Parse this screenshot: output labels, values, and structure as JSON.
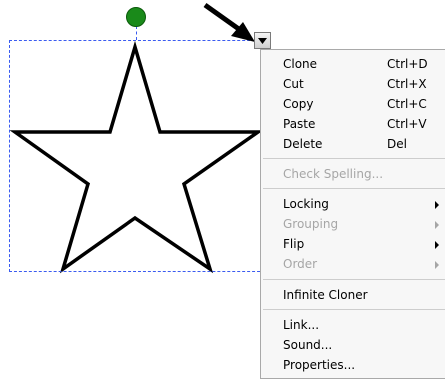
{
  "menu": {
    "clone": {
      "label": "Clone",
      "shortcut": "Ctrl+D"
    },
    "cut": {
      "label": "Cut",
      "shortcut": "Ctrl+X"
    },
    "copy": {
      "label": "Copy",
      "shortcut": "Ctrl+C"
    },
    "paste": {
      "label": "Paste",
      "shortcut": "Ctrl+V"
    },
    "delete": {
      "label": "Delete",
      "shortcut": "Del"
    },
    "check_spelling": {
      "label": "Check Spelling..."
    },
    "locking": {
      "label": "Locking"
    },
    "grouping": {
      "label": "Grouping"
    },
    "flip": {
      "label": "Flip"
    },
    "order": {
      "label": "Order"
    },
    "infinite_cloner": {
      "label": "Infinite Cloner"
    },
    "link": {
      "label": "Link..."
    },
    "sound": {
      "label": "Sound..."
    },
    "properties": {
      "label": "Properties..."
    }
  },
  "icons": {
    "rotation_handle": "green-circle-rotation-handle",
    "menu_dropdown": "triangle-down-icon",
    "pointer": "black-arrow-icon",
    "submenu": "triangle-right-icon"
  },
  "colors": {
    "selection_border": "#3a5bf0",
    "rotation_handle": "#1a8a1a",
    "disabled_text": "#a6a6a6"
  }
}
